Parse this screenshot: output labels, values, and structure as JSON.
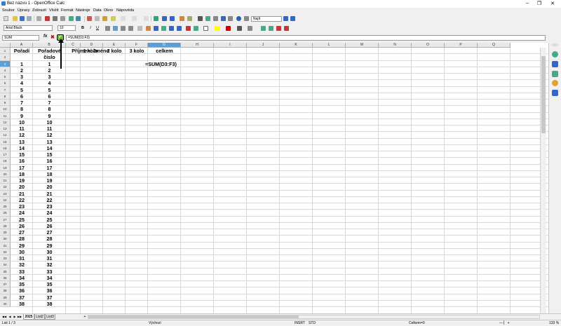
{
  "window": {
    "title": "Bez názvu 1 - OpenOffice Calc"
  },
  "menu": [
    "Soubor",
    "Úpravy",
    "Zobrazit",
    "Vložit",
    "Formát",
    "Nástroje",
    "Data",
    "Okno",
    "Nápověda"
  ],
  "format": {
    "font_name": "Arial Black",
    "font_size": "10",
    "style_box": "Najít"
  },
  "formula_bar": {
    "name_box": "SUM",
    "formula": "=SUM(D3:F3)"
  },
  "columns": [
    "A",
    "B",
    "C",
    "D",
    "E",
    "F",
    "G",
    "H",
    "I",
    "J",
    "K",
    "L",
    "M",
    "N",
    "O",
    "P",
    "Q"
  ],
  "selected_column": "G",
  "selected_row": "3",
  "header_row": {
    "A": "Pořadí",
    "B1": "Pořadové",
    "B2": "číslo",
    "C": "Příjmení Jméno",
    "D": "1 kolo",
    "E": "2 kolo",
    "F": "3 kolo",
    "G": "celkem"
  },
  "editing_cell_text": "=SUM(D3:F3)",
  "rows": [
    "1",
    "2",
    "3",
    "4",
    "5",
    "6",
    "7",
    "8",
    "9",
    "10",
    "11",
    "12",
    "13",
    "14",
    "15",
    "16",
    "17",
    "18",
    "19",
    "20",
    "21",
    "22",
    "23",
    "24",
    "25",
    "26",
    "27",
    "28",
    "29",
    "30",
    "31",
    "32",
    "33",
    "34",
    "35",
    "36",
    "37",
    "38",
    "39",
    "40"
  ],
  "col_a_values": [
    "1",
    "2",
    "3",
    "4",
    "5",
    "6",
    "7",
    "8",
    "9",
    "10",
    "11",
    "12",
    "13",
    "14",
    "15",
    "16",
    "17",
    "18",
    "19",
    "20",
    "21",
    "22",
    "23",
    "24",
    "25",
    "26",
    "27",
    "28",
    "29",
    "30",
    "31",
    "32",
    "33",
    "34",
    "35",
    "36",
    "37",
    "38"
  ],
  "col_b_values": [
    "1",
    "2",
    "3",
    "4",
    "5",
    "6",
    "7",
    "8",
    "9",
    "10",
    "11",
    "12",
    "13",
    "14",
    "15",
    "16",
    "17",
    "18",
    "19",
    "20",
    "21",
    "22",
    "23",
    "24",
    "25",
    "26",
    "27",
    "28",
    "29",
    "30",
    "31",
    "32",
    "33",
    "34",
    "35",
    "36",
    "37",
    "38"
  ],
  "sheet_tabs": [
    "2025",
    "List2",
    "List3"
  ],
  "status": {
    "sheet": "List 1 / 3",
    "page_style": "Výchozí",
    "mode": "INSRT",
    "std": "STD",
    "sum": "Celkem=0",
    "zoom": "133 %"
  }
}
